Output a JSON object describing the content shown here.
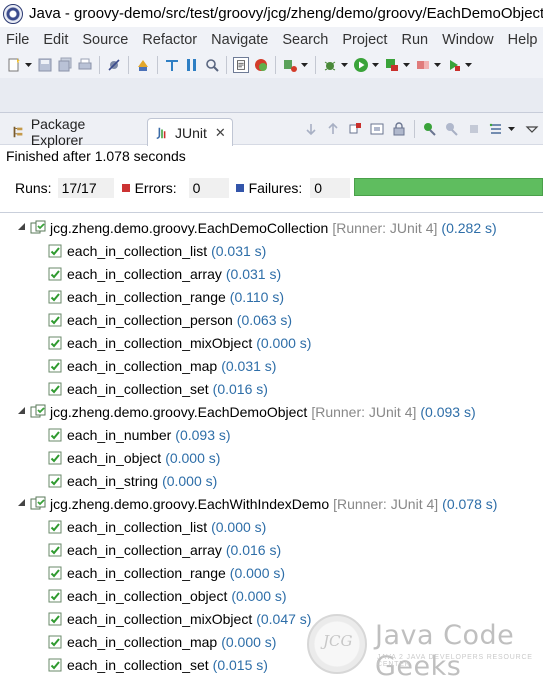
{
  "window": {
    "title": "Java - groovy-demo/src/test/groovy/jcg/zheng/demo/groovy/EachDemoObject.groovy - Eclipse"
  },
  "menu": [
    "File",
    "Edit",
    "Source",
    "Refactor",
    "Navigate",
    "Search",
    "Project",
    "Run",
    "Window",
    "Help"
  ],
  "tabs": {
    "package_explorer": "Package Explorer",
    "junit": "JUnit",
    "close_glyph": "✕"
  },
  "junit": {
    "status": "Finished after 1.078 seconds",
    "runs_label": "Runs:",
    "runs_value": "17/17",
    "errors_label": "Errors:",
    "errors_value": "0",
    "failures_label": "Failures:",
    "failures_value": "0",
    "progress": 1.0,
    "suites": [
      {
        "name": "jcg.zheng.demo.groovy.EachDemoCollection",
        "runner": "[Runner: JUnit 4]",
        "time": "(0.282 s)",
        "tests": [
          {
            "name": "each_in_collection_list",
            "time": "(0.031 s)"
          },
          {
            "name": "each_in_collection_array",
            "time": "(0.031 s)"
          },
          {
            "name": "each_in_collection_range",
            "time": "(0.110 s)"
          },
          {
            "name": "each_in_collection_person",
            "time": "(0.063 s)"
          },
          {
            "name": "each_in_collection_mixObject",
            "time": "(0.000 s)"
          },
          {
            "name": "each_in_collection_map",
            "time": "(0.031 s)"
          },
          {
            "name": "each_in_collection_set",
            "time": "(0.016 s)"
          }
        ]
      },
      {
        "name": "jcg.zheng.demo.groovy.EachDemoObject",
        "runner": "[Runner: JUnit 4]",
        "time": "(0.093 s)",
        "tests": [
          {
            "name": "each_in_number",
            "time": "(0.093 s)"
          },
          {
            "name": "each_in_object",
            "time": "(0.000 s)"
          },
          {
            "name": "each_in_string",
            "time": "(0.000 s)"
          }
        ]
      },
      {
        "name": "jcg.zheng.demo.groovy.EachWithIndexDemo",
        "runner": "[Runner: JUnit 4]",
        "time": "(0.078 s)",
        "tests": [
          {
            "name": "each_in_collection_list",
            "time": "(0.000 s)"
          },
          {
            "name": "each_in_collection_array",
            "time": "(0.016 s)"
          },
          {
            "name": "each_in_collection_range",
            "time": "(0.000 s)"
          },
          {
            "name": "each_in_collection_object",
            "time": "(0.000 s)"
          },
          {
            "name": "each_in_collection_mixObject",
            "time": "(0.047 s)"
          },
          {
            "name": "each_in_collection_map",
            "time": "(0.000 s)"
          },
          {
            "name": "each_in_collection_set",
            "time": "(0.015 s)"
          }
        ]
      }
    ]
  },
  "watermark": {
    "seal": "JCG",
    "brand": "Java Code Geeks",
    "tagline": "JAVA 2 JAVA DEVELOPERS RESOURCE CENTER"
  },
  "colors": {
    "progress_green": "#5fbd5f",
    "time_blue": "#2e6ea8",
    "runner_gray": "#888888",
    "error_red": "#cc3333",
    "failure_blue": "#3355aa"
  }
}
